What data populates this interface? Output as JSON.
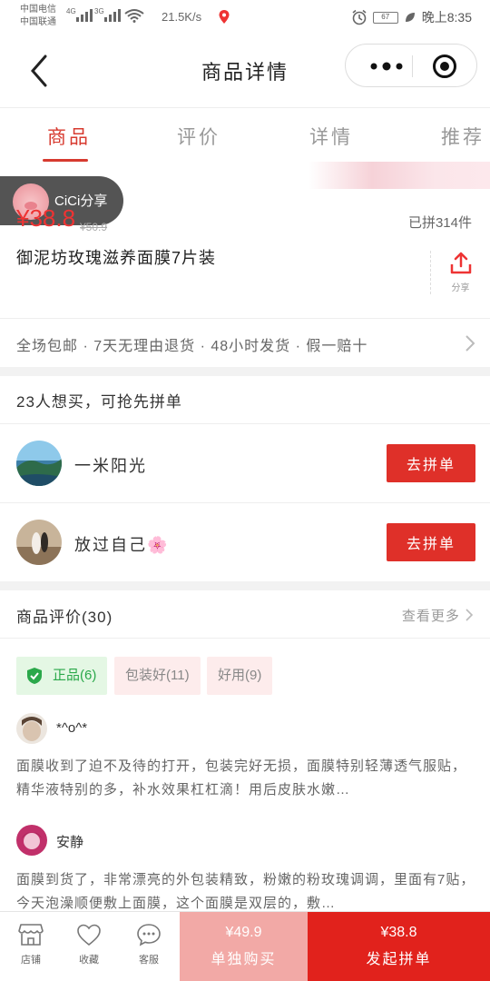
{
  "status_bar": {
    "carrier1": "中国电信",
    "carrier2": "中国联通",
    "net1": "4G",
    "net2": "3G",
    "speed": "21.5K/s",
    "battery": "67",
    "time": "晚上8:35"
  },
  "header": {
    "title": "商品详情"
  },
  "tabs": [
    {
      "label": "商品",
      "active": true
    },
    {
      "label": "评价",
      "active": false
    },
    {
      "label": "详情",
      "active": false
    },
    {
      "label": "推荐",
      "active": false
    }
  ],
  "share_pill": {
    "label": "CiCi分享"
  },
  "product": {
    "price": "¥38.8",
    "old_price": "¥50.9",
    "sold": "已拼314件",
    "title": "御泥坊玫瑰滋养面膜7片装",
    "share_label": "分享",
    "services": "全场包邮 · 7天无理由退货 · 48小时发货 · 假一赔十"
  },
  "group_buy": {
    "heading": "23人想买，可抢先拼单",
    "members": [
      {
        "name": "一米阳光",
        "button": "去拼单"
      },
      {
        "name": "放过自己",
        "emoji": "🌸",
        "button": "去拼单"
      }
    ]
  },
  "reviews": {
    "heading": "商品评价(30)",
    "more": "查看更多",
    "chips": [
      {
        "label": "正品(6)"
      },
      {
        "label": "包装好(11)"
      },
      {
        "label": "好用(9)"
      }
    ],
    "items": [
      {
        "user": "*^o^*",
        "text": "面膜收到了迫不及待的打开，包装完好无损，面膜特别轻薄透气服贴，精华液特别的多，补水效果杠杠滴！用后皮肤水嫩…"
      },
      {
        "user": "安静",
        "text": "面膜到货了，非常漂亮的外包装精致，粉嫩的粉玫瑰调调，里面有7贴，今天泡澡顺便敷上面膜，这个面膜是双层的，敷…"
      }
    ]
  },
  "bottom_bar": {
    "store": "店铺",
    "favorite": "收藏",
    "service": "客服",
    "alone_price": "¥49.9",
    "alone_label": "单独购买",
    "group_price": "¥38.8",
    "group_label": "发起拼单"
  },
  "colors": {
    "accent": "#d73a2f",
    "button_red": "#df3029",
    "alone_pink": "#f2a9a6",
    "green_chip": "#2aa84a"
  }
}
